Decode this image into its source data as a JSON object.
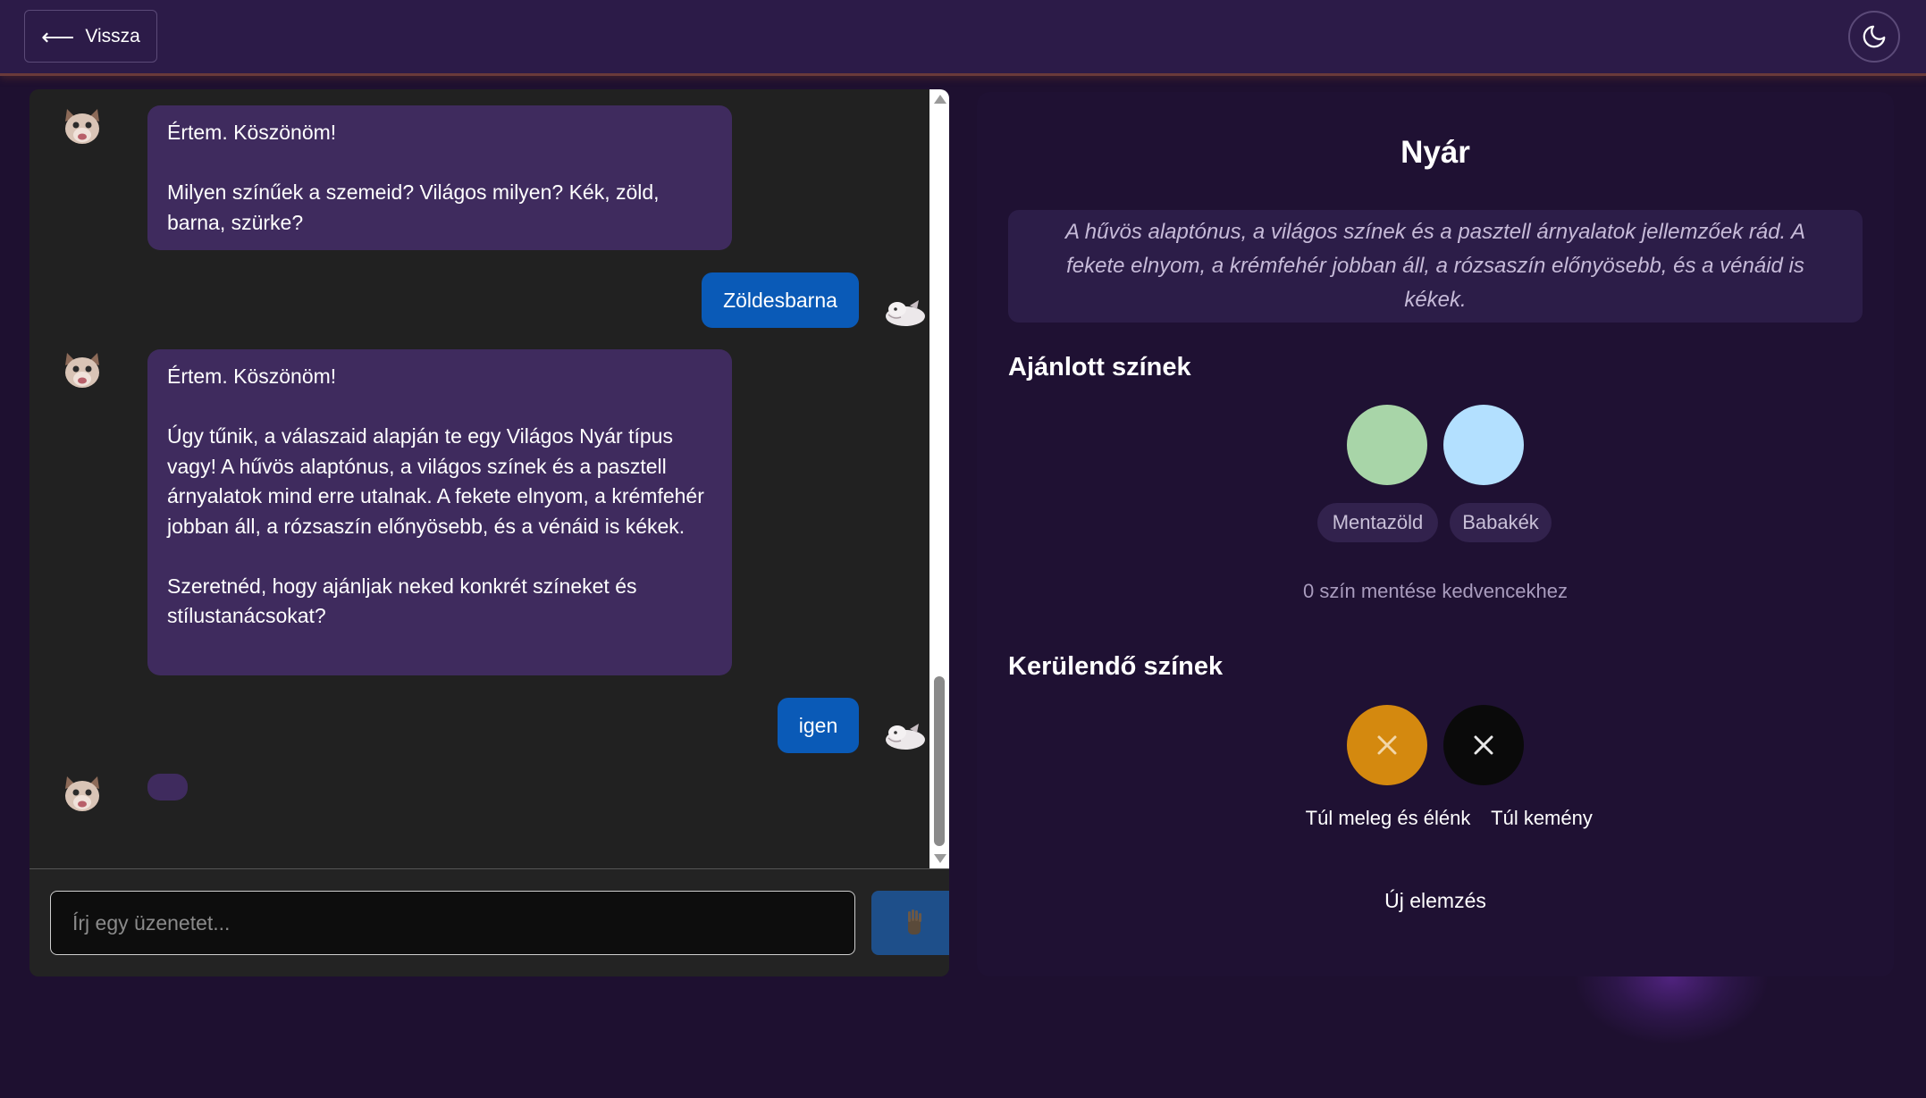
{
  "header": {
    "back_label": "Vissza",
    "theme_icon": "moon-icon"
  },
  "chat": {
    "messages": [
      {
        "role": "bot",
        "text": "Értem. Köszönöm!\n\nMilyen színűek a szemeid? Világos milyen? Kék, zöld, barna, szürke?"
      },
      {
        "role": "user",
        "text": "Zöldesbarna"
      },
      {
        "role": "bot",
        "text": "Értem. Köszönöm!\n\nÚgy tűnik, a válaszaid alapján te egy Világos Nyár típus vagy! A hűvös alaptónus, a világos színek és a pasztell árnyalatok mind erre utalnak. A fekete elnyom, a krémfehér jobban áll, a rózsaszín előnyösebb, és a vénáid is kékek.\n\nSzeretnéd, hogy ajánljak neked konkrét színeket és stílustanácsokat?"
      },
      {
        "role": "user",
        "text": "igen"
      }
    ],
    "input_placeholder": "Írj egy üzenetet...",
    "input_value": "",
    "send_icon": "hand-icon"
  },
  "result": {
    "title": "Nyár",
    "description": "A hűvös alaptónus, a világos színek és a pasztell árnyalatok jellemzőek rád. A fekete elnyom, a krémfehér jobban áll, a rózsaszín előnyösebb, és a vénáid is kékek.",
    "recommended_heading": "Ajánlott színek",
    "recommended": [
      {
        "name": "Mentazöld",
        "color": "#a8d5a8"
      },
      {
        "name": "Babakék",
        "color": "#b3e0ff"
      }
    ],
    "save_text": "0 szín mentése kedvencekhez",
    "avoid_heading": "Kerülendő színek",
    "avoid": [
      {
        "name": "Túl meleg és élénk",
        "color": "#d4890f"
      },
      {
        "name": "Túl kemény",
        "color": "#0a0a0a"
      }
    ],
    "new_analysis_label": "Új elemzés"
  }
}
